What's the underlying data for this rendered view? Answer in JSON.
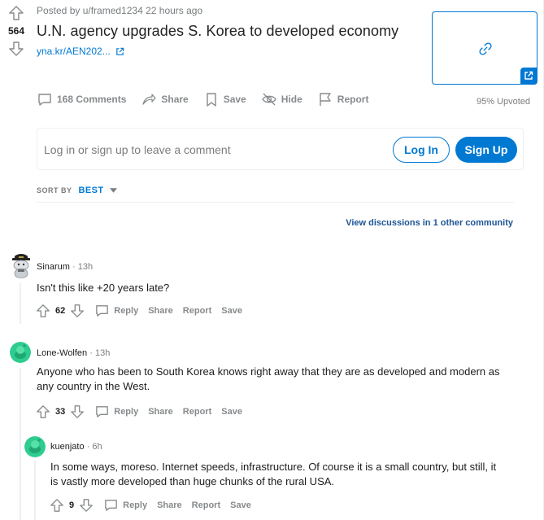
{
  "post": {
    "votes": "564",
    "meta": "Posted by u/framed1234 22 hours ago",
    "title": "U.N. agency upgrades S. Korea to developed economy",
    "link_text": "yna.kr/AEN202...",
    "actions": {
      "comments": "168 Comments",
      "share": "Share",
      "save": "Save",
      "hide": "Hide",
      "report": "Report"
    },
    "upvoted": "95% Upvoted"
  },
  "comment_box": {
    "prompt": "Log in or sign up to leave a comment",
    "login": "Log In",
    "signup": "Sign Up"
  },
  "sort": {
    "label": "SORT BY",
    "value": "BEST"
  },
  "other_community": {
    "prefix": "View discussions in ",
    "count": "1",
    "suffix": " other community"
  },
  "comments": [
    {
      "user": "Sinarum",
      "dot": "·",
      "time": "13h",
      "text": "Isn't this like +20 years late?",
      "score": "62",
      "reply": "Reply",
      "share": "Share",
      "report": "Report",
      "save": "Save"
    },
    {
      "user": "Lone-Wolfen",
      "dot": "·",
      "time": "13h",
      "text_line1": "Anyone who has been to South Korea knows right away that they are as developed and modern as",
      "text_line2": "any country in the West.",
      "score": "33",
      "reply": "Reply",
      "share": "Share",
      "report": "Report",
      "save": "Save"
    },
    {
      "user": "kuenjato",
      "dot": "·",
      "time": "6h",
      "text_line1": "In some ways, moreso. Internet speeds, infrastructure. Of course it is a small country, but still, it",
      "text_line2": "is vastly more developed than huge chunks of the rural USA.",
      "score": "9",
      "reply": "Reply",
      "share": "Share",
      "report": "Report",
      "save": "Save"
    }
  ],
  "colors": {
    "accent": "#0079d3",
    "muted": "#878a8c",
    "snoo_green": "#2ecc8f"
  }
}
